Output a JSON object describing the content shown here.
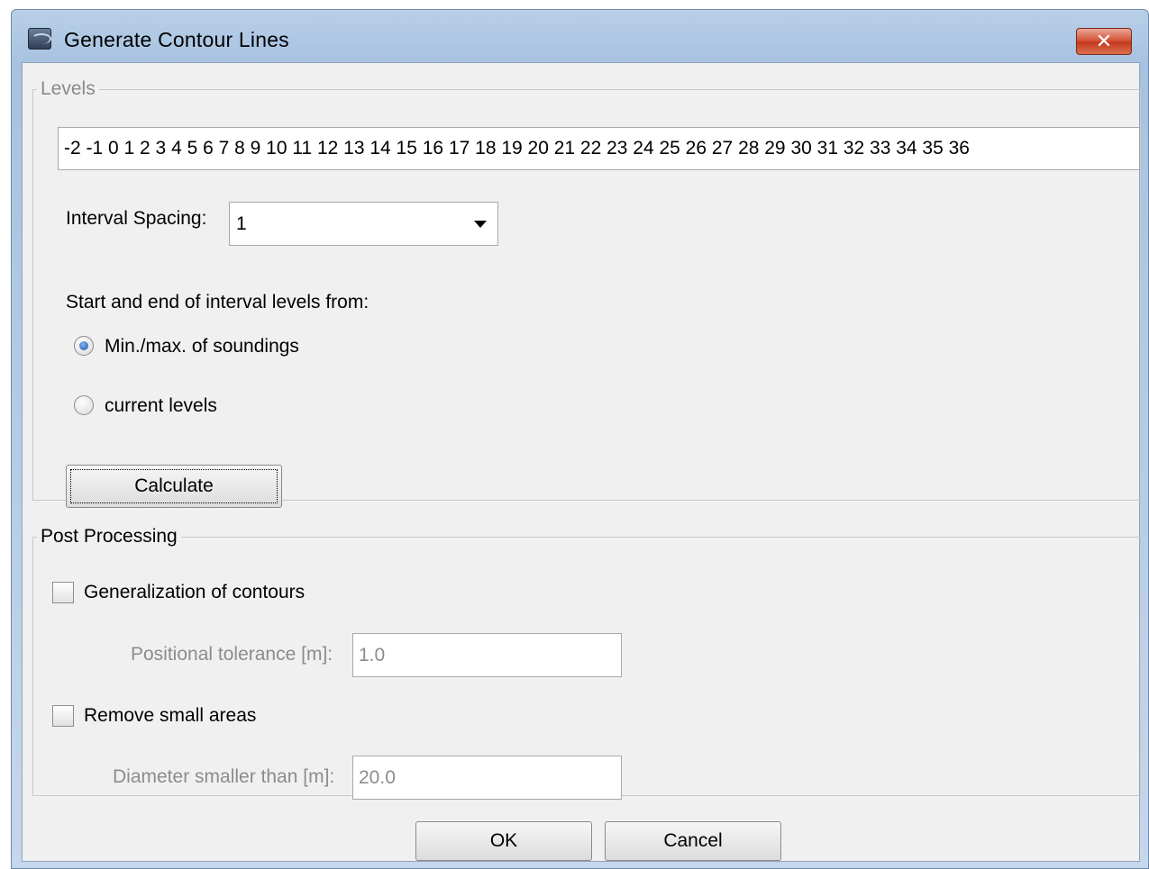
{
  "window": {
    "title": "Generate Contour Lines",
    "close_label": "✕"
  },
  "levels": {
    "legend": "Levels",
    "value": "-2 -1 0 1 2 3 4 5 6 7 8 9 10 11 12 13 14 15 16 17 18 19 20 21 22 23 24 25 26 27 28 29 30 31 32 33 34 35 36",
    "interval_label": "Interval Spacing:",
    "interval_value": "1",
    "range_label": "Start and end of interval levels from:",
    "radio_options": [
      {
        "label": "Min./max. of soundings",
        "checked": true
      },
      {
        "label": "current levels",
        "checked": false
      }
    ],
    "calculate_label": "Calculate"
  },
  "post_processing": {
    "legend": "Post Processing",
    "generalization_label": "Generalization of contours",
    "generalization_checked": false,
    "tolerance_label": "Positional tolerance [m]:",
    "tolerance_value": "1.0",
    "remove_label": "Remove small areas",
    "remove_checked": false,
    "diameter_label": "Diameter smaller than [m]:",
    "diameter_value": "20.0"
  },
  "footer": {
    "ok_label": "OK",
    "cancel_label": "Cancel"
  }
}
